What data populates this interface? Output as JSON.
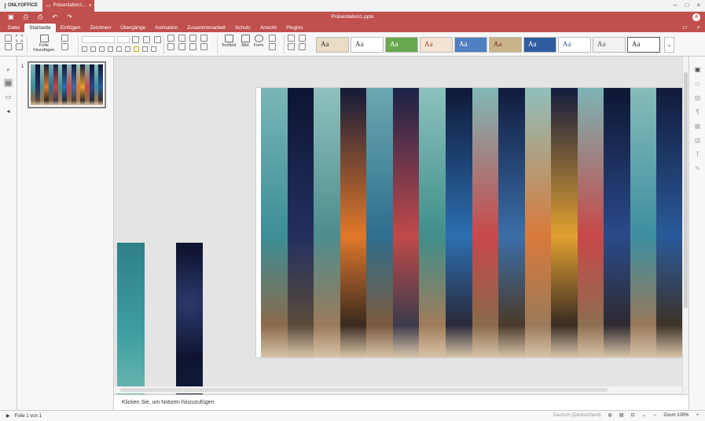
{
  "app": {
    "name": "ONLYOFFICE",
    "doc_tab": "Präsentation1...",
    "doc_title": "Präsentation1.pptx",
    "avatar": "A"
  },
  "menu": [
    "Datei",
    "Startseite",
    "Einfügen",
    "Zeichnen",
    "Übergänge",
    "Animation",
    "Zusammenarbeit",
    "Schutz",
    "Ansicht",
    "Plugins"
  ],
  "toolbar": {
    "add_slide": "Folie hinzufügen",
    "textfield": "Textfeld",
    "image": "Bild",
    "shape": "Form"
  },
  "themes": [
    {
      "label": "Aa",
      "bg": "#e8dcc4",
      "fg": "#333333"
    },
    {
      "label": "Aa",
      "bg": "#ffffff",
      "fg": "#333333"
    },
    {
      "label": "Aa",
      "bg": "#6aa84f",
      "fg": "#ffffff"
    },
    {
      "label": "Aa",
      "bg": "#f3e3d3",
      "fg": "#a84a2a"
    },
    {
      "label": "Aa",
      "bg": "#4f7fc0",
      "fg": "#ffffff"
    },
    {
      "label": "Aa",
      "bg": "#c9b48a",
      "fg": "#7a1f1f"
    },
    {
      "label": "Aa",
      "bg": "#2e5d9e",
      "fg": "#ffffff"
    },
    {
      "label": "Aa",
      "bg": "#ffffff",
      "fg": "#2e5d9e"
    },
    {
      "label": "Aa",
      "bg": "#f2f2f2",
      "fg": "#555555"
    },
    {
      "label": "Aa",
      "bg": "#ffffff",
      "fg": "#333333"
    }
  ],
  "thumbnails": [
    {
      "number": "1"
    }
  ],
  "notes_placeholder": "Klicken Sie, um Notizen hinzuzufügen",
  "status": {
    "slide_info": "Folie 1 von 1",
    "language": "Deutsch (Deutschland)",
    "zoom": "Zoom 100%"
  }
}
